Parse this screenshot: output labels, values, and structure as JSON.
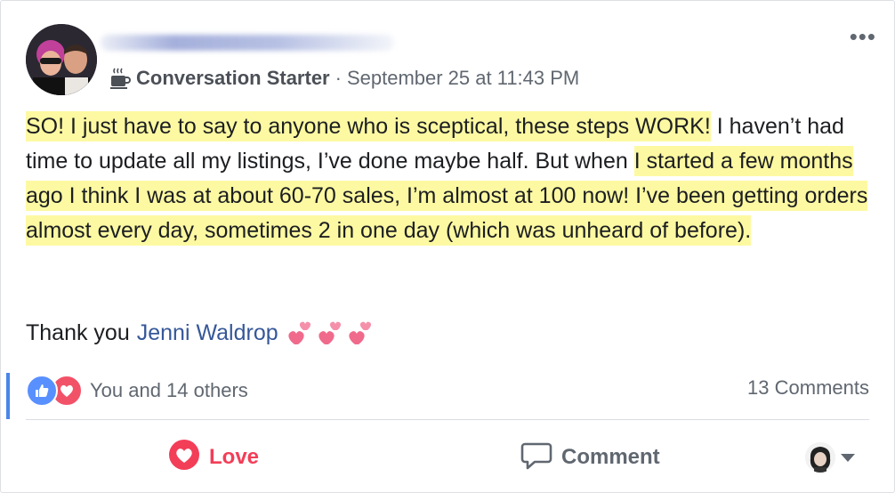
{
  "post": {
    "author_name_redacted": true,
    "badge_label": "Conversation Starter",
    "separator": "·",
    "timestamp": "September 25 at 11:43 PM",
    "body": {
      "highlight_1": "SO! I just have to say to anyone who is sceptical, these steps WORK!",
      "plain_1": " I haven’t had time to update all my listings, I’ve done maybe half. But when ",
      "highlight_2": "I started a few months ago I think I was at about 60-70 sales, I’m almost at 100 now! I’ve been getting orders almost every day, sometimes 2 in one day (which was unheard of before)."
    },
    "thanks_text": "Thank you",
    "mention": "Jenni Waldrop",
    "emoji": "💕💕💕"
  },
  "reactions": {
    "summary": "You and 14 others",
    "types": [
      "like",
      "love"
    ],
    "comments_count": "13 Comments"
  },
  "actions": {
    "love_label": "Love",
    "comment_label": "Comment"
  },
  "colors": {
    "highlight": "#fdf9a2",
    "link": "#365899",
    "love": "#f33e58",
    "like_badge": "#5890ff",
    "secondary_text": "#606770"
  },
  "icons": {
    "more": "more-options-icon",
    "badge": "coffee-cup-icon",
    "like": "thumbs-up-icon",
    "love": "heart-icon",
    "comment": "speech-bubble-icon",
    "caret": "caret-down-icon"
  }
}
